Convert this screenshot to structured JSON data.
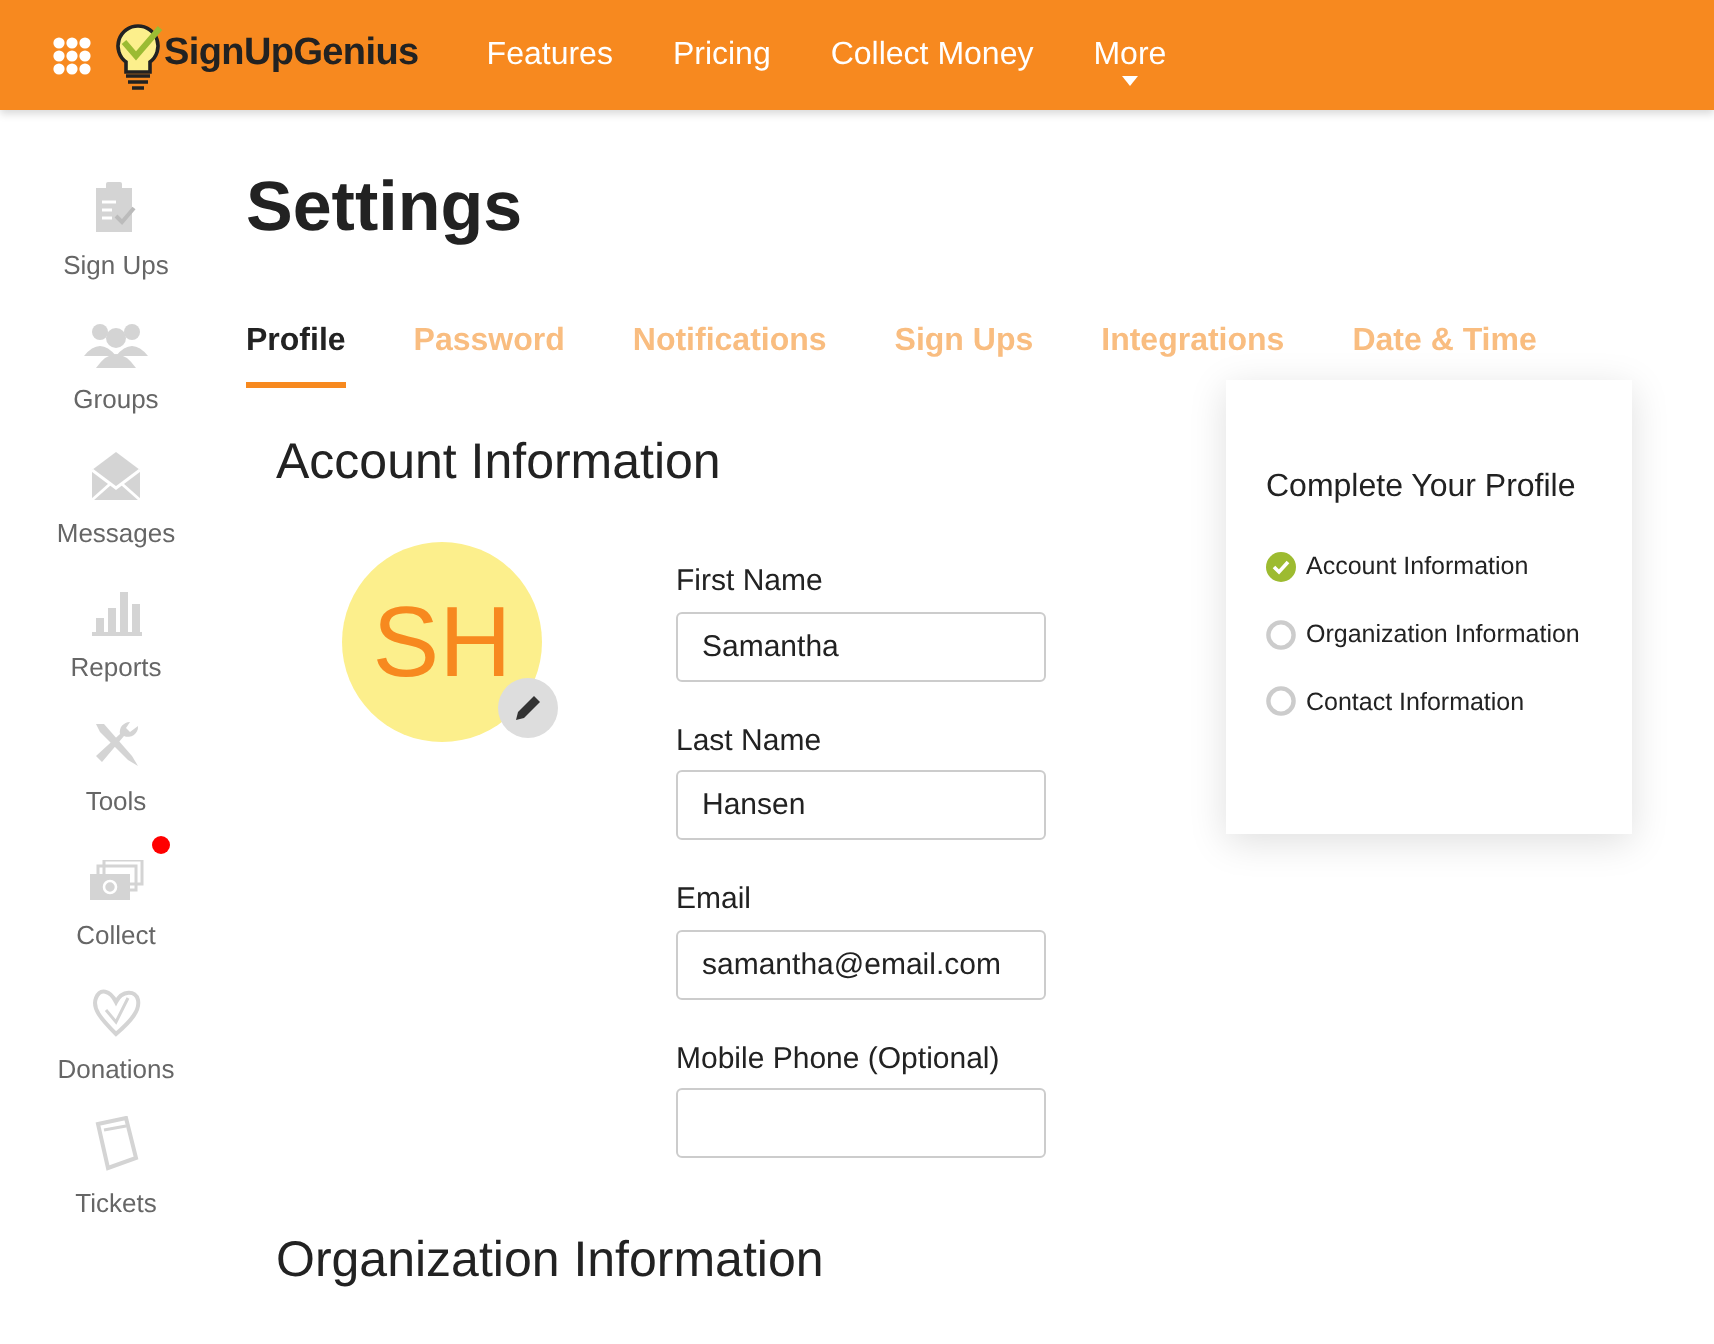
{
  "navbar": {
    "brand": "SignUpGenius",
    "links": [
      {
        "label": "Features"
      },
      {
        "label": "Pricing"
      },
      {
        "label": "Collect Money"
      },
      {
        "label": "More",
        "dropdown": true
      }
    ]
  },
  "sidebar": {
    "items": [
      {
        "label": "Sign Ups",
        "notification": false
      },
      {
        "label": "Groups",
        "notification": false
      },
      {
        "label": "Messages",
        "notification": false
      },
      {
        "label": "Reports",
        "notification": false
      },
      {
        "label": "Tools",
        "notification": false
      },
      {
        "label": "Collect",
        "notification": true
      },
      {
        "label": "Donations",
        "notification": false
      },
      {
        "label": "Tickets",
        "notification": false
      }
    ]
  },
  "page_title": "Settings",
  "tabs": [
    {
      "label": "Profile",
      "selected": true
    },
    {
      "label": "Password",
      "selected": false
    },
    {
      "label": "Notifications",
      "selected": false
    },
    {
      "label": "Sign Ups",
      "selected": false
    },
    {
      "label": "Integrations",
      "selected": false
    },
    {
      "label": "Date & Time",
      "selected": false
    }
  ],
  "account_section": {
    "heading": "Account Information",
    "avatar_initials": "SH",
    "fields": [
      {
        "label": "First Name",
        "value": "Samantha"
      },
      {
        "label": "Last Name",
        "value": "Hansen"
      },
      {
        "label": "Email",
        "value": "samantha@email.com"
      },
      {
        "label": "Mobile Phone (Optional)"
      }
    ]
  },
  "profile_card": {
    "title": "Complete Your Profile",
    "steps": [
      {
        "label": "Account Information",
        "checked": true
      },
      {
        "label": "Organization Information",
        "checked": false
      },
      {
        "label": "Contact Information",
        "checked": false
      }
    ]
  },
  "next_section": {
    "heading": "Organization Information"
  }
}
